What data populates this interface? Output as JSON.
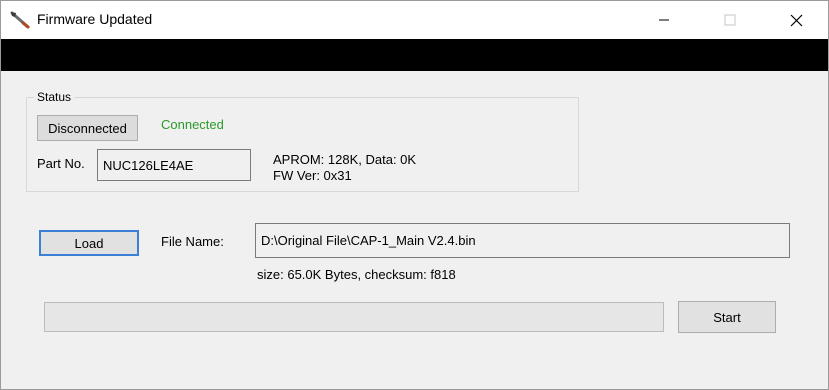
{
  "window": {
    "title": "Firmware Updated",
    "icons": {
      "app": "tool-wrench-icon",
      "minimize": "minimize-icon",
      "maximize": "maximize-icon",
      "close": "close-icon"
    }
  },
  "status": {
    "group_label": "Status",
    "disconnect_button": "Disconnected",
    "connection_text": "Connected",
    "connection_color": "#2a9a2a",
    "part_label": "Part No.",
    "part_value": "NUC126LE4AE",
    "aprom_info": "APROM: 128K, Data: 0K",
    "fw_version": "FW Ver: 0x31"
  },
  "file": {
    "load_button": "Load",
    "file_label": "File Name:",
    "file_path": "D:\\Original File\\CAP-1_Main V2.4.bin",
    "size_info": "size: 65.0K Bytes, checksum: f818"
  },
  "progress": {
    "value": 0
  },
  "actions": {
    "start_button": "Start"
  },
  "colors": {
    "accent": "#3c7fd6",
    "titlebar": "#ffffff",
    "banner": "#000000"
  }
}
